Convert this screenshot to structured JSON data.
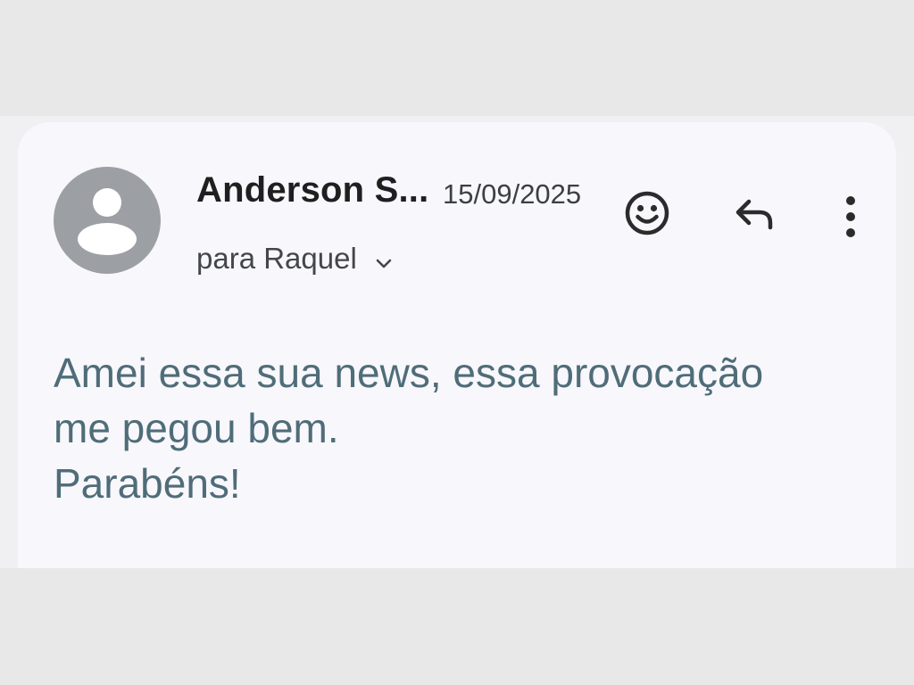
{
  "email": {
    "sender": "Anderson S...",
    "date": "15/09/2025",
    "recipient_label": "para Raquel",
    "body_lines": [
      "Amei essa sua news, essa provocação",
      "me pegou bem.",
      "Parabéns!"
    ]
  },
  "icons": {
    "avatar": "person-avatar-icon",
    "recipient_toggle": "chevron-down-icon",
    "reaction": "emoji-smile-icon",
    "reply": "reply-icon",
    "more": "more-vert-icon"
  },
  "colors": {
    "card_background": "#f8f7fc",
    "page_background": "#e8e8e8",
    "avatar_background": "#9ca0a5",
    "body_text": "#4f6d78"
  }
}
